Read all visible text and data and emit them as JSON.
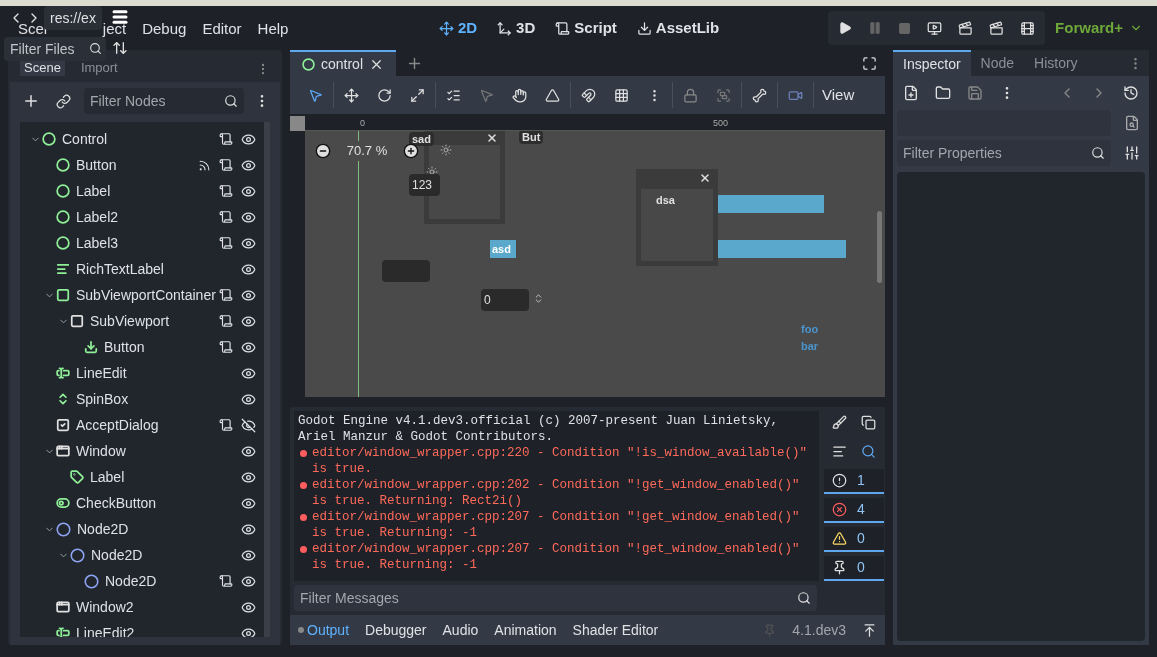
{
  "top_bar": {
    "menu": [
      "Scer",
      "ject",
      "Debug",
      "Editor",
      "Help"
    ],
    "main_screens": [
      {
        "label": "2D",
        "kind": "planar",
        "selected": true
      },
      {
        "label": "3D",
        "kind": "spatial",
        "selected": false
      },
      {
        "label": "Script",
        "kind": "script",
        "selected": false
      },
      {
        "label": "AssetLib",
        "kind": "library",
        "selected": false
      }
    ],
    "renderer": "Forward+"
  },
  "popups": {
    "path_tooltip": "res://ex",
    "filter_files": {
      "placeholder": "Filter Files"
    }
  },
  "scene_dock": {
    "tabs": [
      {
        "label": "Scene",
        "selected": true
      },
      {
        "label": "Import",
        "selected": false
      }
    ],
    "filter": {
      "placeholder": "Filter Nodes"
    },
    "tree": [
      {
        "name": "Control",
        "kind": "control",
        "color": "#8eef97",
        "script": true,
        "signal": false,
        "visible": true,
        "expanded": true,
        "children": [
          {
            "name": "Button",
            "kind": "control",
            "color": "#8eef97",
            "script": true,
            "signal": true,
            "visible": true
          },
          {
            "name": "Label",
            "kind": "control",
            "color": "#8eef97",
            "script": true,
            "signal": false,
            "visible": true
          },
          {
            "name": "Label2",
            "kind": "control",
            "color": "#8eef97",
            "script": true,
            "signal": false,
            "visible": true
          },
          {
            "name": "Label3",
            "kind": "control",
            "color": "#8eef97",
            "script": true,
            "signal": false,
            "visible": true
          },
          {
            "name": "RichTextLabel",
            "kind": "text",
            "color": "#8eef97",
            "script": false,
            "signal": false,
            "visible": true
          },
          {
            "name": "SubViewportContainer",
            "kind": "container",
            "color": "#8eef97",
            "script": true,
            "signal": false,
            "visible": true,
            "expanded": true,
            "children": [
              {
                "name": "SubViewport",
                "kind": "viewport",
                "color": "#e0e0e0",
                "script": true,
                "signal": false,
                "visible": true,
                "expanded": true,
                "children": [
                  {
                    "name": "Button",
                    "kind": "button",
                    "color": "#8eef97",
                    "script": true,
                    "signal": false,
                    "visible": true
                  }
                ]
              }
            ]
          },
          {
            "name": "LineEdit",
            "kind": "lineedit",
            "color": "#8eef97",
            "script": false,
            "signal": false,
            "visible": true
          },
          {
            "name": "SpinBox",
            "kind": "spinbox",
            "color": "#8eef97",
            "script": false,
            "signal": false,
            "visible": true
          },
          {
            "name": "AcceptDialog",
            "kind": "dialog",
            "color": "#e0e0e0",
            "script": true,
            "signal": false,
            "visible": false
          },
          {
            "name": "Window",
            "kind": "window",
            "color": "#e0e0e0",
            "script": false,
            "signal": false,
            "visible": true,
            "expanded": true,
            "children": [
              {
                "name": "Label",
                "kind": "tag",
                "color": "#8eef97",
                "script": false,
                "signal": false,
                "visible": true
              }
            ]
          },
          {
            "name": "CheckButton",
            "kind": "toggle",
            "color": "#8eef97",
            "script": false,
            "signal": false,
            "visible": true
          },
          {
            "name": "Node2D",
            "kind": "node",
            "color": "#8da5f3",
            "script": false,
            "signal": false,
            "visible": true,
            "expanded": true,
            "children": [
              {
                "name": "Node2D",
                "kind": "node",
                "color": "#8da5f3",
                "script": false,
                "signal": false,
                "visible": true,
                "expanded": true,
                "children": [
                  {
                    "name": "Node2D",
                    "kind": "node",
                    "color": "#8da5f3",
                    "script": true,
                    "signal": false,
                    "visible": true
                  }
                ]
              }
            ]
          },
          {
            "name": "Window2",
            "kind": "window",
            "color": "#e0e0e0",
            "script": false,
            "signal": false,
            "visible": true
          },
          {
            "name": "LineEdit2",
            "kind": "lineedit",
            "color": "#8eef97",
            "script": false,
            "signal": false,
            "visible": true
          }
        ]
      }
    ]
  },
  "editor_tabs": [
    {
      "label": "control",
      "selected": true
    }
  ],
  "toolbar": {
    "view_menu": "View"
  },
  "canvas": {
    "zoom": "70.7 %",
    "ruler_labels": [
      "0",
      "500"
    ],
    "nodes": [
      {
        "kind": "tab-label",
        "text": "sad"
      },
      {
        "kind": "tab-label",
        "text": "But"
      },
      {
        "kind": "field",
        "text": "123"
      },
      {
        "kind": "highlight",
        "text": "asd"
      },
      {
        "kind": "window-text",
        "text": "dsa"
      },
      {
        "kind": "spin",
        "text": "0"
      },
      {
        "kind": "blue-text",
        "text": "foo"
      },
      {
        "kind": "blue-text",
        "text": "bar"
      }
    ]
  },
  "output": {
    "lines": [
      {
        "kind": "info",
        "text": "Godot Engine v4.1.dev3.official (c) 2007-present Juan Linietsky, Ariel Manzur & Godot Contributors."
      },
      {
        "kind": "error",
        "text": "editor/window_wrapper.cpp:220 - Condition \"!is_window_available()\" is true."
      },
      {
        "kind": "error",
        "text": "editor/window_wrapper.cpp:202 - Condition \"!get_window_enabled()\" is true. Returning: Rect2i()"
      },
      {
        "kind": "error",
        "text": "editor/window_wrapper.cpp:207 - Condition \"!get_window_enabled()\" is true. Returning: -1"
      },
      {
        "kind": "error",
        "text": "editor/window_wrapper.cpp:207 - Condition \"!get_window_enabled()\" is true. Returning: -1"
      }
    ],
    "filter": {
      "placeholder": "Filter Messages"
    },
    "counters": [
      {
        "kind": "message",
        "count": "1"
      },
      {
        "kind": "error",
        "count": "4"
      },
      {
        "kind": "warning",
        "count": "0"
      },
      {
        "kind": "editor",
        "count": "0"
      }
    ]
  },
  "bottom_panel": {
    "tabs": [
      {
        "label": "Output",
        "selected": true
      },
      {
        "label": "Debugger",
        "selected": false
      },
      {
        "label": "Audio",
        "selected": false
      },
      {
        "label": "Animation",
        "selected": false
      },
      {
        "label": "Shader Editor",
        "selected": false
      }
    ],
    "version": "4.1.dev3"
  },
  "inspector": {
    "tabs": [
      {
        "label": "Inspector",
        "selected": true
      },
      {
        "label": "Node",
        "selected": false
      },
      {
        "label": "History",
        "selected": false
      }
    ],
    "filter": {
      "placeholder": "Filter Properties"
    }
  }
}
